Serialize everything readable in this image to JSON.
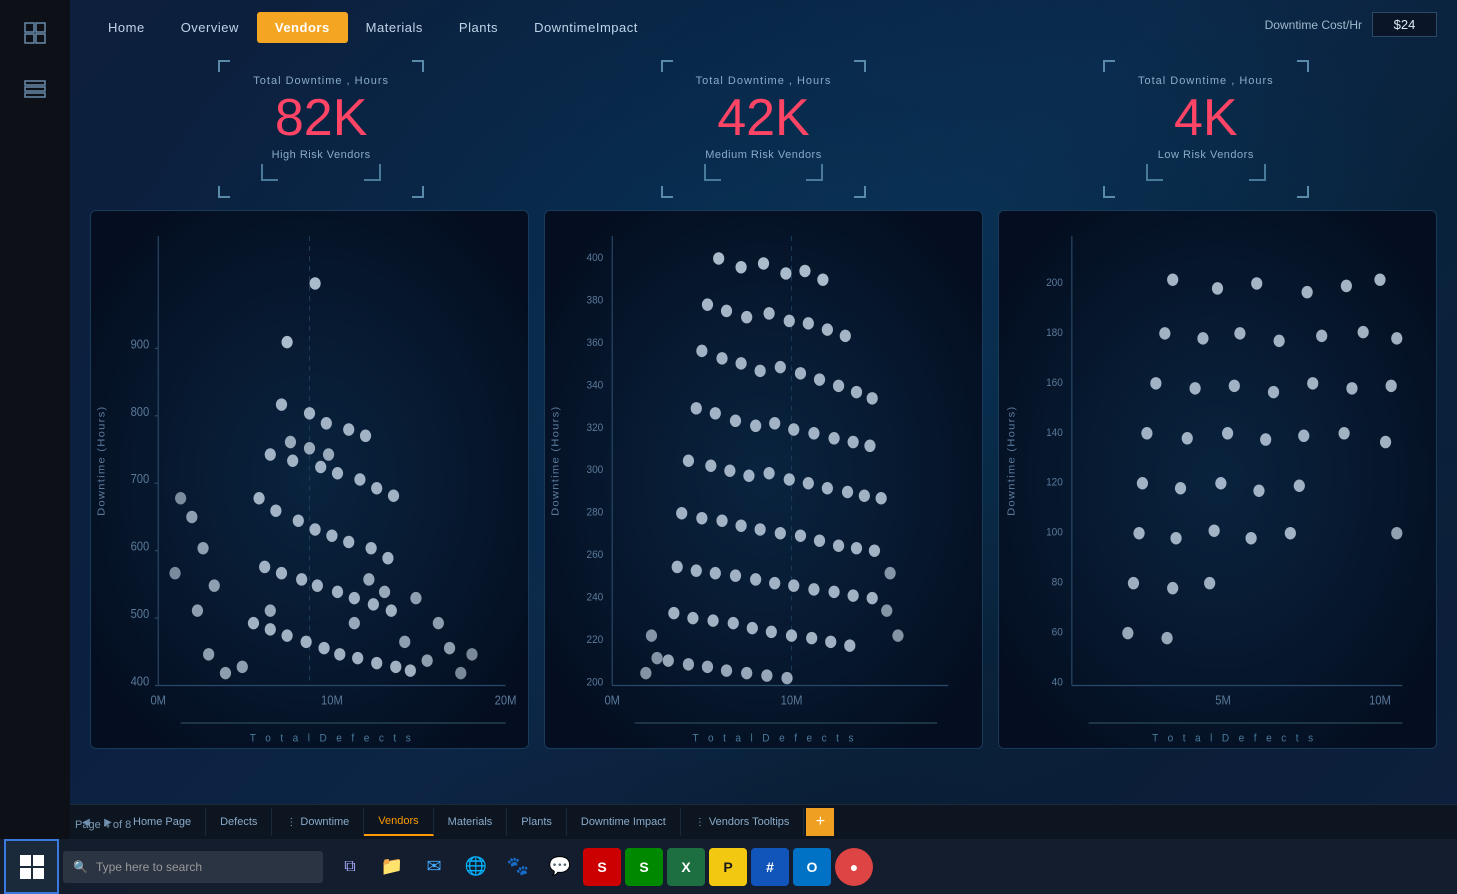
{
  "nav": {
    "items": [
      {
        "label": "Home",
        "active": false
      },
      {
        "label": "Overview",
        "active": false
      },
      {
        "label": "Vendors",
        "active": true
      },
      {
        "label": "Materials",
        "active": false
      },
      {
        "label": "Plants",
        "active": false
      },
      {
        "label": "DowntimeImpact",
        "active": false
      }
    ]
  },
  "cost_control": {
    "label": "Downtime Cost/Hr",
    "value": "$24"
  },
  "metrics": [
    {
      "label": "Total Downtime , Hours",
      "value": "82K",
      "sublabel": "High Risk Vendors"
    },
    {
      "label": "Total Downtime , Hours",
      "value": "42K",
      "sublabel": "Medium Risk Vendors"
    },
    {
      "label": "Total Downtime , Hours",
      "value": "4K",
      "sublabel": "Low Risk Vendors"
    }
  ],
  "charts": [
    {
      "title": "High Risk Vendors",
      "y_axis": "Downtime (Hours)",
      "x_axis": "Total  D e f e c t s",
      "y_ticks": [
        "400",
        "500",
        "600",
        "700",
        "800",
        "900"
      ],
      "x_ticks": [
        "0M",
        "10M",
        "20M"
      ]
    },
    {
      "title": "Medium Risk Vendors",
      "y_axis": "Downtime (Hours)",
      "x_axis": "Total  D e f e c t s",
      "y_ticks": [
        "200",
        "220",
        "240",
        "260",
        "280",
        "300",
        "320",
        "340",
        "360",
        "380",
        "400"
      ],
      "x_ticks": [
        "0M",
        "10M"
      ]
    },
    {
      "title": "Low Risk Vendors",
      "y_axis": "Downtime (Hours)",
      "x_axis": "Total  D e f e c t s",
      "y_ticks": [
        "40",
        "60",
        "80",
        "100",
        "120",
        "140",
        "160",
        "180",
        "200"
      ],
      "x_ticks": [
        "5M",
        "10M"
      ]
    }
  ],
  "tabs": [
    {
      "label": "Home Page",
      "active": false,
      "icon": ""
    },
    {
      "label": "Defects",
      "active": false,
      "icon": ""
    },
    {
      "label": "Downtime",
      "active": false,
      "icon": "⋮"
    },
    {
      "label": "Vendors",
      "active": true,
      "icon": ""
    },
    {
      "label": "Materials",
      "active": false,
      "icon": ""
    },
    {
      "label": "Plants",
      "active": false,
      "icon": ""
    },
    {
      "label": "Downtime Impact",
      "active": false,
      "icon": ""
    },
    {
      "label": "Vendors Tooltips",
      "active": false,
      "icon": "⋮"
    }
  ],
  "status": {
    "page_info": "Page 4 of 8"
  },
  "taskbar": {
    "search_placeholder": "Type here to search",
    "apps": [
      {
        "icon": "⊞",
        "name": "windows-icon",
        "color": "#fff"
      },
      {
        "icon": "🔍",
        "name": "search-icon",
        "color": "#fff"
      },
      {
        "icon": "⊡",
        "name": "task-view-icon",
        "color": "#fff"
      },
      {
        "icon": "📁",
        "name": "explorer-icon",
        "color": "#ffd700"
      },
      {
        "icon": "📧",
        "name": "mail-icon",
        "color": "#4af"
      },
      {
        "icon": "🌐",
        "name": "chrome-icon",
        "color": "#4af"
      },
      {
        "icon": "🐕",
        "name": "dog-icon",
        "color": "#4af"
      },
      {
        "icon": "📨",
        "name": "whatsapp-icon",
        "color": "#4af"
      },
      {
        "icon": "📱",
        "name": "app1-icon",
        "color": "#f44"
      },
      {
        "icon": "🟢",
        "name": "app2-icon",
        "color": "#4f4"
      },
      {
        "icon": "📊",
        "name": "excel-icon",
        "color": "#2f2"
      },
      {
        "icon": "📊",
        "name": "powerbi-icon",
        "color": "#fa0"
      },
      {
        "icon": "🔢",
        "name": "calc-icon",
        "color": "#06f"
      },
      {
        "icon": "📬",
        "name": "outlook-icon",
        "color": "#06f"
      },
      {
        "icon": "🔷",
        "name": "app3-icon",
        "color": "#f40"
      }
    ]
  },
  "sidebar": {
    "icons": [
      {
        "name": "grid-icon",
        "symbol": "⊞"
      },
      {
        "name": "layers-icon",
        "symbol": "⊟"
      }
    ]
  }
}
